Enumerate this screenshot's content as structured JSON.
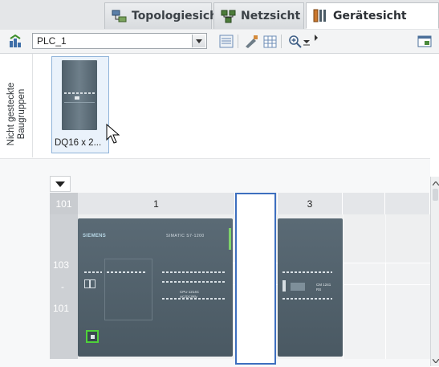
{
  "tabs": [
    {
      "label": "Topologiesicht",
      "icon": "topology-icon",
      "active": false
    },
    {
      "label": "Netzsicht",
      "icon": "network-icon",
      "active": false
    },
    {
      "label": "Gerätesicht",
      "icon": "device-icon",
      "active": true
    }
  ],
  "toolbar": {
    "device_select_value": "PLC_1",
    "buttons": [
      "device-add-icon",
      "dropdown-arrow-icon",
      "properties-icon",
      "draw-icon",
      "grid-icon",
      "zoom-icon",
      "zoom-dropdown-icon",
      "overview-icon"
    ]
  },
  "unplugged_modules": {
    "strip_label_line1": "Nicht gesteckte",
    "strip_label_line2": "Baugruppen",
    "module_label": "DQ16 x 2..."
  },
  "rack": {
    "row_label": "101",
    "slots": [
      "1",
      "",
      "3",
      "",
      ""
    ],
    "rail_labels": [
      "103",
      "-",
      "101"
    ]
  },
  "modules": {
    "cpu": {
      "brand": "SIEMENS",
      "type": "SIMATIC S7-1200",
      "model_line1": "CPU 1214C",
      "model_line2": "AC/DC/Rly"
    },
    "cm": {
      "label_line1": "CM 1241",
      "label_line2": "RS"
    }
  },
  "colors": {
    "selection": "#3d6fbf",
    "module_body": "#4f5e68",
    "port_highlight": "#4fd23a",
    "active_tab_text": "#2c3035"
  }
}
